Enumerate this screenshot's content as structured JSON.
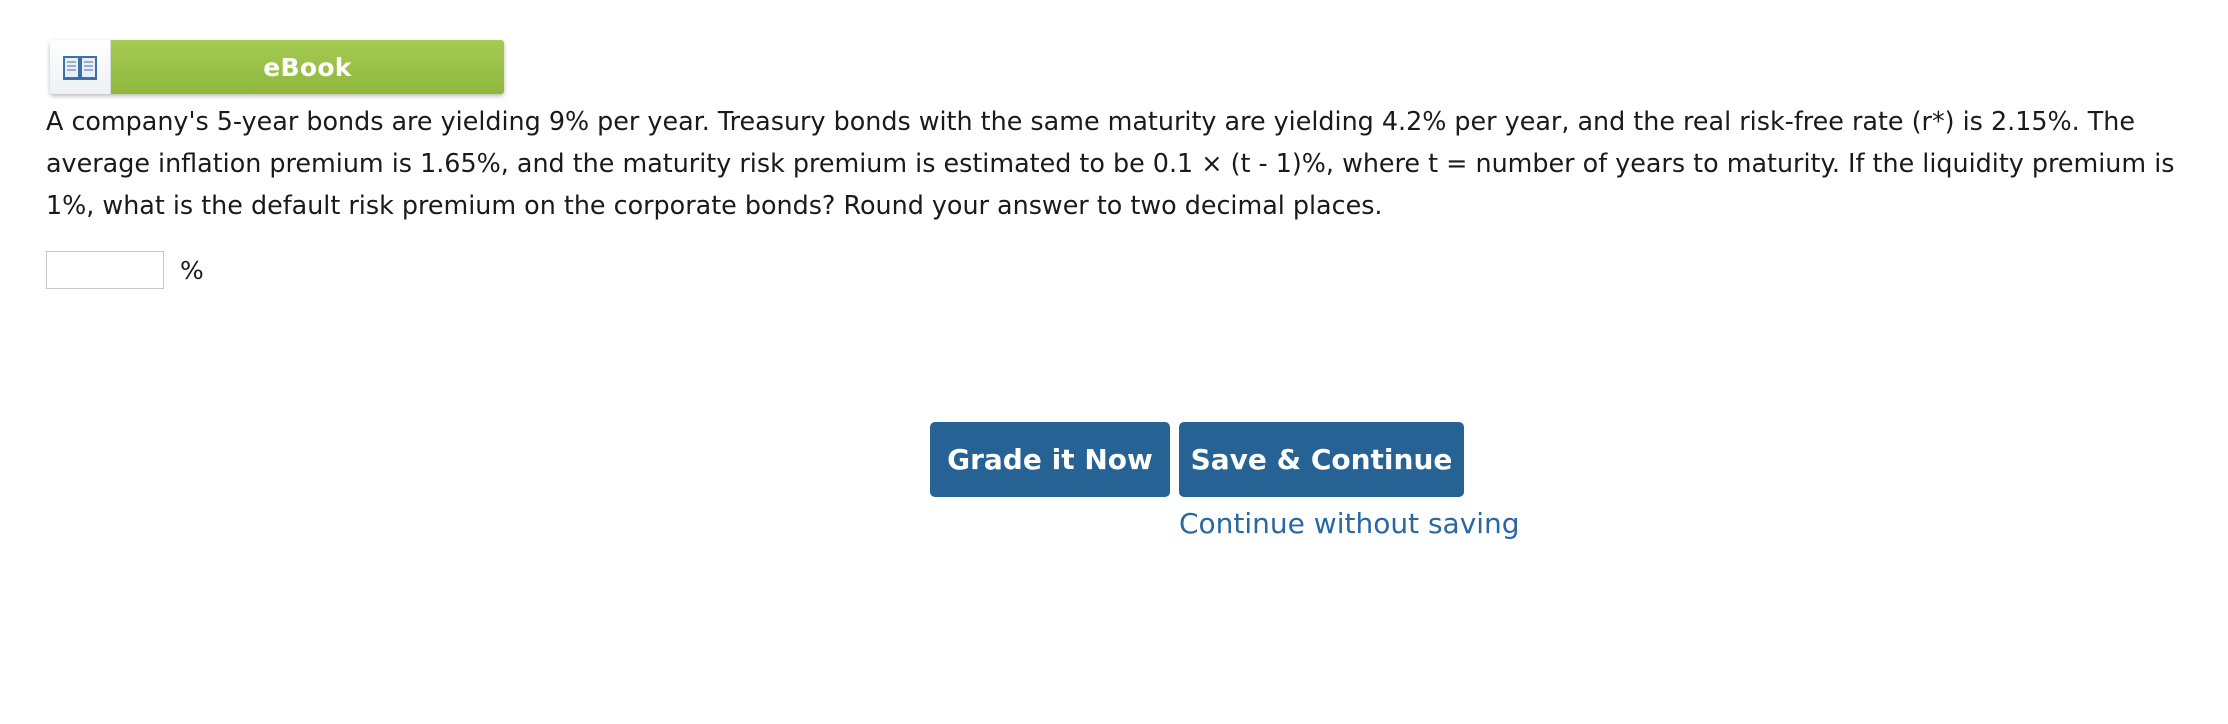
{
  "ebook": {
    "label": "eBook",
    "icon": "open-book-icon"
  },
  "question": {
    "text": "A company's 5-year bonds are yielding 9% per year. Treasury bonds with the same maturity are yielding 4.2% per year, and the real risk-free rate (r*) is 2.15%. The average inflation premium is 1.65%, and the maturity risk premium is estimated to be 0.1 × (t - 1)%, where t = number of years to maturity. If the liquidity premium is 1%, what is the default risk premium on the corporate bonds? Round your answer to two decimal places."
  },
  "answer": {
    "value": "",
    "unit": "%"
  },
  "actions": {
    "grade_label": "Grade it Now",
    "save_label": "Save & Continue",
    "continue_label": "Continue without saving"
  },
  "colors": {
    "ebook_green": "#9cc147",
    "button_blue": "#266293",
    "link_blue": "#2a67a3"
  }
}
